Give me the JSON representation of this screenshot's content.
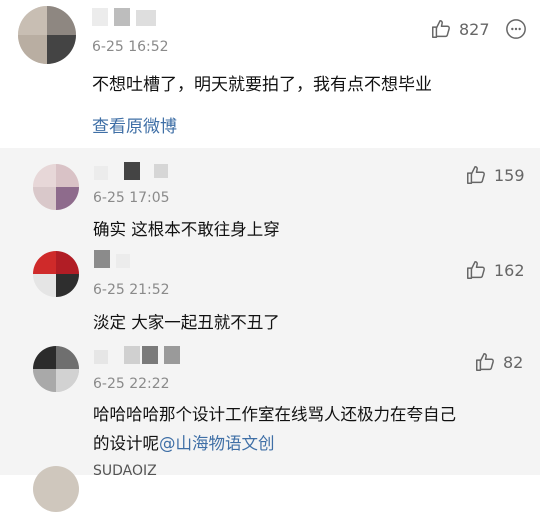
{
  "main_comment": {
    "time": "6-25 16:52",
    "text": "不想吐槽了，明天就要拍了，我有点不想毕业",
    "view_link": "查看原微博",
    "likes": "827"
  },
  "replies": [
    {
      "time": "6-25 17:05",
      "text": "确实  这根本不敢往身上穿",
      "likes": "159"
    },
    {
      "time": "6-25 21:52",
      "text": "淡定 大家一起丑就不丑了",
      "likes": "162"
    },
    {
      "time": "6-25 22:22",
      "text_line1": "哈哈哈哈那个设计工作室在线骂人还极力在夸自己",
      "text_line2_prefix": "的设计呢",
      "mention": "@山海物语文创",
      "likes": "82"
    },
    {
      "name_partial": "SUDAOIZ"
    }
  ],
  "icons": {
    "like": "thumbs-up-icon",
    "more": "more-options-icon"
  },
  "colors": {
    "link": "#3f6fa6",
    "reply_bg": "#f4f4f4"
  }
}
